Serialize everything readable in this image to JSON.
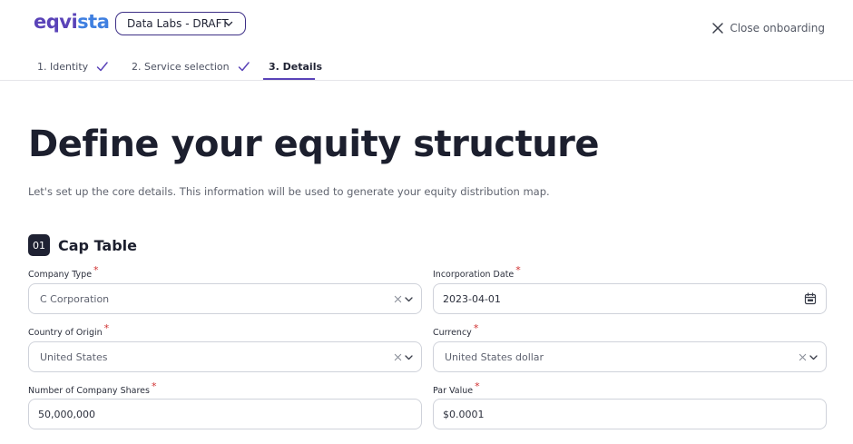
{
  "header": {
    "logo_text": "eqvista",
    "company_selector": "Data Labs - DRAFT",
    "close_label": "Close onboarding"
  },
  "steps": [
    {
      "label": "1. Identity",
      "done": true
    },
    {
      "label": "2. Service selection",
      "done": true
    },
    {
      "label": "3. Details",
      "done": false,
      "active": true
    }
  ],
  "page": {
    "title": "Define your equity structure",
    "subtitle": "Let's set up the core details. This information will be used to generate your equity distribution map."
  },
  "section": {
    "number": "01",
    "title": "Cap Table"
  },
  "fields": {
    "company_type": {
      "label": "Company Type",
      "value": "C Corporation"
    },
    "incorporation_date": {
      "label": "Incorporation Date",
      "value": "2023-04-01"
    },
    "country": {
      "label": "Country of Origin",
      "value": "United States"
    },
    "currency": {
      "label": "Currency",
      "value": "United States dollar"
    },
    "shares": {
      "label": "Number of Company Shares",
      "value": "50,000,000"
    },
    "par_value": {
      "label": "Par Value",
      "value": "$0.0001"
    }
  },
  "colors": {
    "brand": "#5a43b8",
    "required": "#d03030",
    "section_badge": "#1f2233"
  }
}
